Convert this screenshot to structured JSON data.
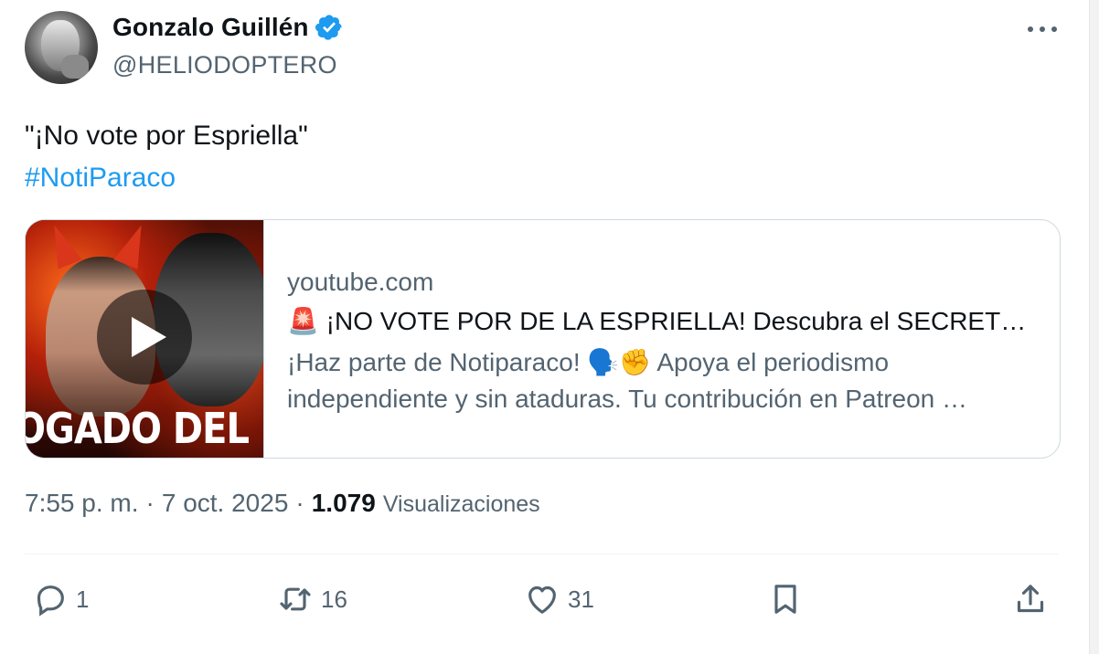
{
  "author": {
    "display_name": "Gonzalo Guillén",
    "handle": "@HELIODOPTERO",
    "verified": true
  },
  "tweet": {
    "text": "\"¡No vote por Espriella\"",
    "hashtag": "#NotiParaco"
  },
  "card": {
    "thumbnail_caption": "OGADO DEL DIABL",
    "domain": "youtube.com",
    "title": "🚨 ¡NO VOTE POR DE LA ESPRIELLA! Descubra el SECRET…",
    "description": "¡Haz parte de Notiparaco! 🗣️✊ Apoya el periodismo independiente y sin ataduras. Tu contribución en Patreon …"
  },
  "meta": {
    "time": "7:55 p. m.",
    "separator": "·",
    "date": "7 oct. 2025",
    "views_count": "1.079",
    "views_label": "Visualizaciones"
  },
  "actions": {
    "replies": "1",
    "reposts": "16",
    "likes": "31"
  },
  "colors": {
    "accent": "#1d9bf0",
    "text_primary": "#0f1419",
    "text_secondary": "#536471",
    "border": "#cfd9de"
  },
  "icons": [
    "verified-badge-icon",
    "more-options-icon",
    "play-icon",
    "reply-icon",
    "repost-icon",
    "like-icon",
    "bookmark-icon",
    "share-icon"
  ]
}
